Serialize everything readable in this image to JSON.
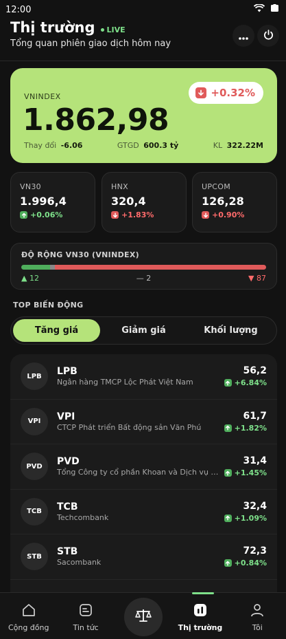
{
  "status_bar": {
    "time": "12:00"
  },
  "header": {
    "title": "Thị trường",
    "live_label": "LIVE",
    "subtitle": "Tổng quan phiên giao dịch hôm nay"
  },
  "hero": {
    "label": "VNINDEX",
    "value": "1.862,98",
    "change_badge": "+0.32%",
    "change_label": "Thay đổi",
    "change_value": "-6.06",
    "gtgd_label": "GTGD",
    "gtgd_value": "600.3 tỷ",
    "kl_label": "KL",
    "kl_value": "322.22M"
  },
  "indices": [
    {
      "label": "VN30",
      "value": "1.996,4",
      "change": "+0.06%",
      "direction": "up"
    },
    {
      "label": "HNX",
      "value": "320,4",
      "change": "+1.83%",
      "direction": "down"
    },
    {
      "label": "UPCOM",
      "value": "126,28",
      "change": "+0.90%",
      "direction": "down"
    }
  ],
  "breadth": {
    "title": "ĐỘ RỘNG VN30 (VNINDEX)",
    "advancers": "12",
    "unchanged": "2",
    "decliners": "87",
    "advancers_count": 12,
    "unchanged_count": 2,
    "decliners_count": 87,
    "flat_prefix": "—"
  },
  "top_movers": {
    "title": "TOP BIẾN ĐỘNG",
    "tabs": [
      "Tăng giá",
      "Giảm giá",
      "Khối lượng"
    ],
    "active_tab": 0,
    "rows": [
      {
        "logo": "LPB",
        "symbol": "LPB",
        "name": "Ngân hàng TMCP Lộc Phát Việt Nam",
        "price": "56,2",
        "change": "+6.84%"
      },
      {
        "logo": "VPI",
        "symbol": "VPI",
        "name": "CTCP Phát triển Bất động sản Văn Phú",
        "price": "61,7",
        "change": "+1.82%"
      },
      {
        "logo": "PVD",
        "symbol": "PVD",
        "name": "Tổng Công ty cổ phần Khoan và Dịch vụ Khoan Dầu khí",
        "price": "31,4",
        "change": "+1.45%"
      },
      {
        "logo": "TCB",
        "symbol": "TCB",
        "name": "Techcombank",
        "price": "32,4",
        "change": "+1.09%"
      },
      {
        "logo": "STB",
        "symbol": "STB",
        "name": "Sacombank",
        "price": "72,3",
        "change": "+0.84%"
      }
    ]
  },
  "bottom_nav": {
    "items": [
      "Cộng đồng",
      "Tin tức",
      "Thị trường",
      "Tôi"
    ],
    "active": "Thị trường"
  },
  "colors": {
    "accent": "#b5e37a",
    "up": "#7ee08a",
    "down": "#ff6b6b",
    "background": "#121212"
  }
}
